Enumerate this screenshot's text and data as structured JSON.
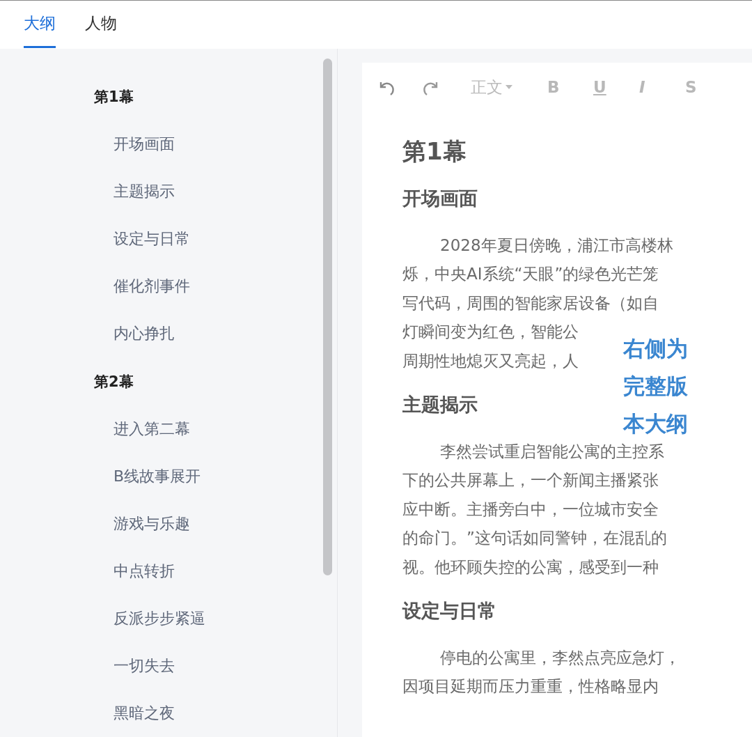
{
  "tabs": [
    {
      "label": "大纲",
      "selected": true
    },
    {
      "label": "人物",
      "selected": false
    }
  ],
  "outline": [
    {
      "label": "第1幕",
      "children": [
        {
          "label": "开场画面"
        },
        {
          "label": "主题揭示"
        },
        {
          "label": "设定与日常"
        },
        {
          "label": "催化剂事件"
        },
        {
          "label": "内心挣扎"
        }
      ]
    },
    {
      "label": "第2幕",
      "children": [
        {
          "label": "进入第二幕"
        },
        {
          "label": "B线故事展开"
        },
        {
          "label": "游戏与乐趣"
        },
        {
          "label": "中点转折"
        },
        {
          "label": "反派步步紧逼"
        },
        {
          "label": "一切失去"
        },
        {
          "label": "黑暗之夜"
        }
      ]
    }
  ],
  "toolbar": [
    {
      "kind": "undo"
    },
    {
      "kind": "redo"
    },
    {
      "kind": "dropdown",
      "label": "正文"
    },
    {
      "kind": "text",
      "label": "B"
    },
    {
      "kind": "text",
      "label": "U"
    },
    {
      "kind": "text",
      "label": "I"
    },
    {
      "kind": "text",
      "label": "S"
    }
  ],
  "document": [
    {
      "kind": "h1",
      "text": "第1幕"
    },
    {
      "kind": "h2",
      "text": "开场画面"
    },
    {
      "kind": "p",
      "lines": [
        "2028年夏日傍晚，浦江市高楼林",
        "烁，中央AI系统“天眼”的绿色光芒笼",
        "写代码，周围的智能家居设备（如自",
        "灯瞬间变为红色，智能公",
        "周期性地熄灭又亮起，人"
      ]
    },
    {
      "kind": "h2",
      "text": "主题揭示"
    },
    {
      "kind": "p",
      "lines": [
        "李然尝试重启智能公寓的主控系",
        "下的公共屏幕上，一个新闻主播紧张",
        "应中断。主播旁白中，一位城市安全",
        "的命门。”这句话如同警钟，在混乱的",
        "视。他环顾失控的公寓，感受到一种"
      ]
    },
    {
      "kind": "h2",
      "text": "设定与日常"
    },
    {
      "kind": "p",
      "lines": [
        "停电的公寓里，李然点亮应急灯，",
        "因项目延期而压力重重，性格略显内"
      ]
    }
  ],
  "note": [
    "右侧为",
    "完整版",
    "本大纲"
  ]
}
